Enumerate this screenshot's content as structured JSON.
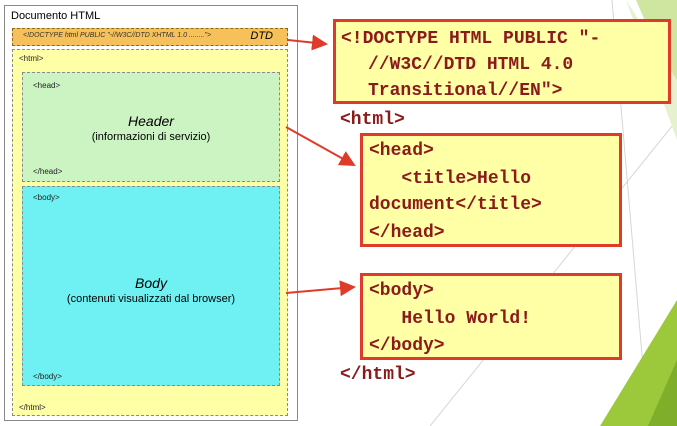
{
  "diagram": {
    "title": "Documento HTML",
    "dtd_text": "<!DOCTYPE html PUBLIC \"-//W3C//DTD XHTML 1.0 ........\">",
    "dtd_label": "DTD",
    "html_open": "<html>",
    "html_close": "</html>",
    "head": {
      "open": "<head>",
      "close": "</head>",
      "title": "Header",
      "subtitle": "(informazioni di servizio)"
    },
    "body": {
      "open": "<body>",
      "close": "</body>",
      "title": "Body",
      "subtitle": "(contenuti visualizzati dal browser)"
    }
  },
  "code": {
    "doctype": [
      "<!DOCTYPE HTML PUBLIC \"-",
      "//W3C//DTD HTML 4.0",
      "Transitional//EN\">"
    ],
    "html_open": "<html>",
    "head": [
      "<head>",
      "   <title>Hello",
      "document</title>",
      "</head>"
    ],
    "body": [
      "<body>",
      "   Hello World!",
      "</body>"
    ],
    "html_close": "</html>"
  },
  "colors": {
    "accent_red": "#e03a2a",
    "code_text": "#8b1a1a",
    "dtd_orange": "#f6c15a",
    "html_yellow": "#ffffa6",
    "head_green": "#ccf4c2",
    "body_cyan": "#6ff0f2",
    "slide_green": "#9cc93c"
  }
}
